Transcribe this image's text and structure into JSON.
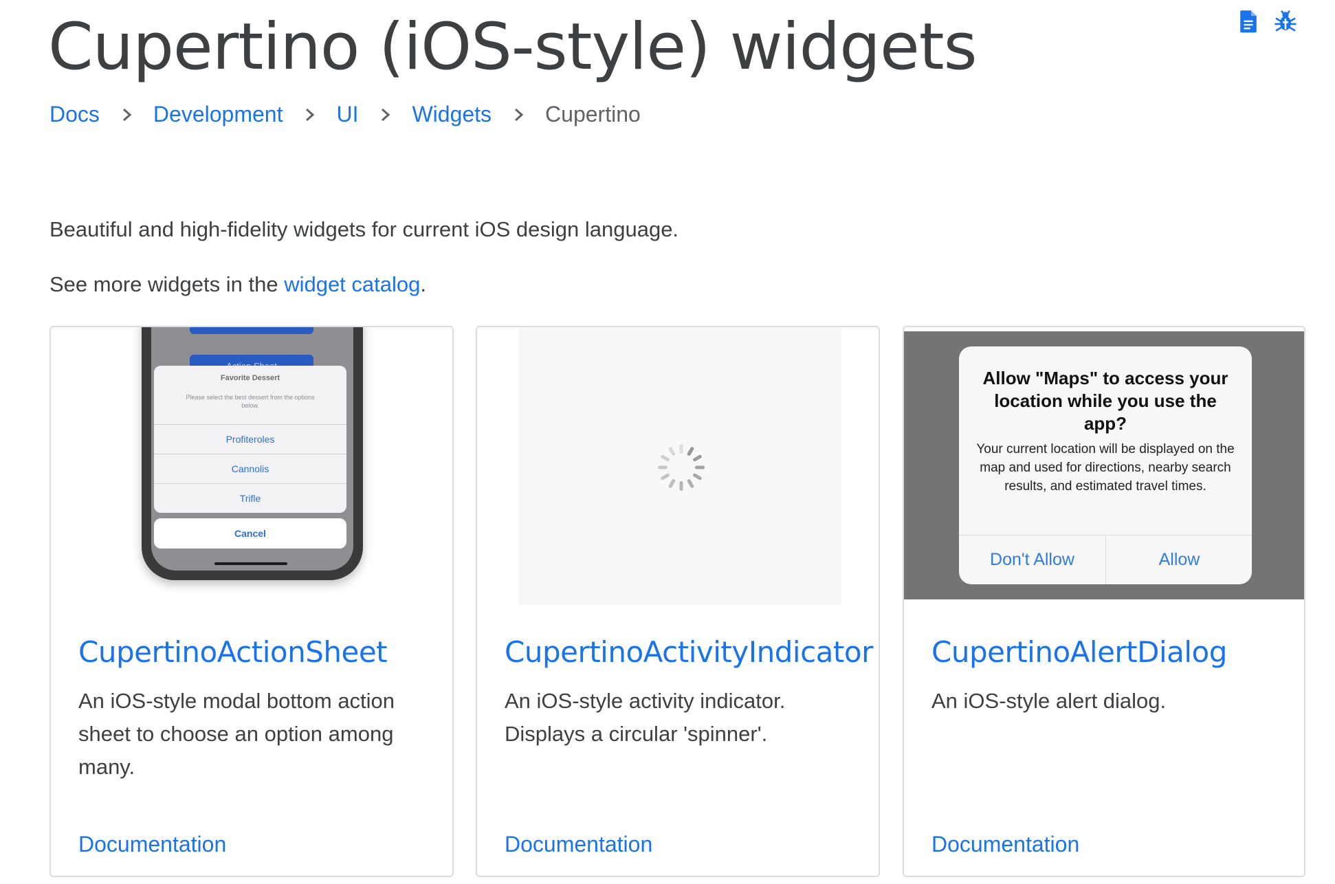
{
  "page": {
    "title": "Cupertino (iOS-style) widgets",
    "icons": [
      "document-icon",
      "bug-icon"
    ]
  },
  "breadcrumb": {
    "items": [
      "Docs",
      "Development",
      "UI",
      "Widgets"
    ],
    "current": "Cupertino"
  },
  "intro": {
    "text": "Beautiful and high-fidelity widgets for current iOS design language.",
    "see_more_prefix": "See more widgets in the ",
    "catalog_link": "widget catalog",
    "see_more_suffix": "."
  },
  "cards": [
    {
      "title": "CupertinoActionSheet",
      "description": "An iOS-style modal bottom action sheet to choose an option among many.",
      "link": "Documentation",
      "preview": {
        "button_label": "Action Sheet",
        "sheet_title": "Favorite Dessert",
        "sheet_message": "Please select the best dessert from the options below.",
        "options": [
          "Profiteroles",
          "Cannolis",
          "Trifle"
        ],
        "cancel": "Cancel"
      }
    },
    {
      "title": "CupertinoActivityIndicator",
      "description": "An iOS-style activity indicator. Displays a circular 'spinner'.",
      "link": "Documentation"
    },
    {
      "title": "CupertinoAlertDialog",
      "description": "An iOS-style alert dialog.",
      "link": "Documentation",
      "preview": {
        "alert_title": "Allow \"Maps\" to access your location while you use the app?",
        "alert_message": "Your current location will be displayed on the map and used for directions, nearby search results, and estimated travel times.",
        "deny_label": "Don't Allow",
        "allow_label": "Allow"
      }
    }
  ],
  "colors": {
    "link": "#1a73e8",
    "title": "#3c4043",
    "body_text": "#3c4043",
    "card_border": "#dadce0",
    "ios_blue": "#2f7de1"
  }
}
